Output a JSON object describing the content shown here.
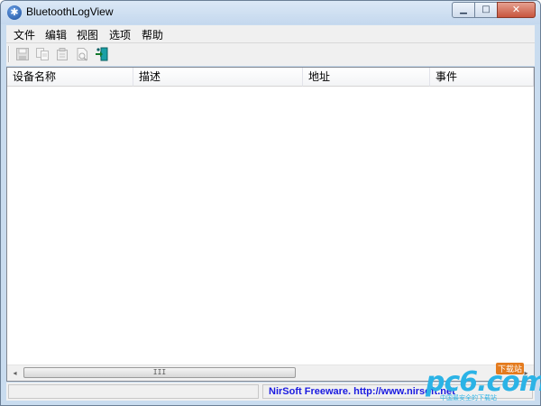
{
  "window": {
    "title": "BluetoothLogView",
    "app_icon_glyph": "✱",
    "controls": {
      "minimize": "▁",
      "maximize": "□",
      "close": "✕"
    }
  },
  "menu": [
    "文件",
    "编辑",
    "视图",
    "选项",
    "帮助"
  ],
  "toolbar": {
    "buttons": [
      {
        "icon": "save-icon",
        "enabled": false
      },
      {
        "icon": "copy-icon",
        "enabled": false
      },
      {
        "icon": "properties-icon",
        "enabled": false
      },
      {
        "icon": "report-icon",
        "enabled": false
      },
      {
        "icon": "exit-icon",
        "enabled": true
      }
    ]
  },
  "table": {
    "columns": [
      "设备名称",
      "描述",
      "地址",
      "事件"
    ],
    "rows": []
  },
  "scrollbar": {
    "left_arrow": "◂",
    "right_arrow": "▸",
    "grip": "III"
  },
  "status": {
    "left": "",
    "right": "NirSoft Freeware.  http://www.nirsoft.net"
  },
  "watermark": {
    "main": "pc6.com",
    "tag": "下载站",
    "sub": "中国最安全的下载站"
  },
  "colors": {
    "status_link": "#1a1ae0",
    "watermark": "#2bb3e6",
    "close_button": "#c8553d"
  }
}
